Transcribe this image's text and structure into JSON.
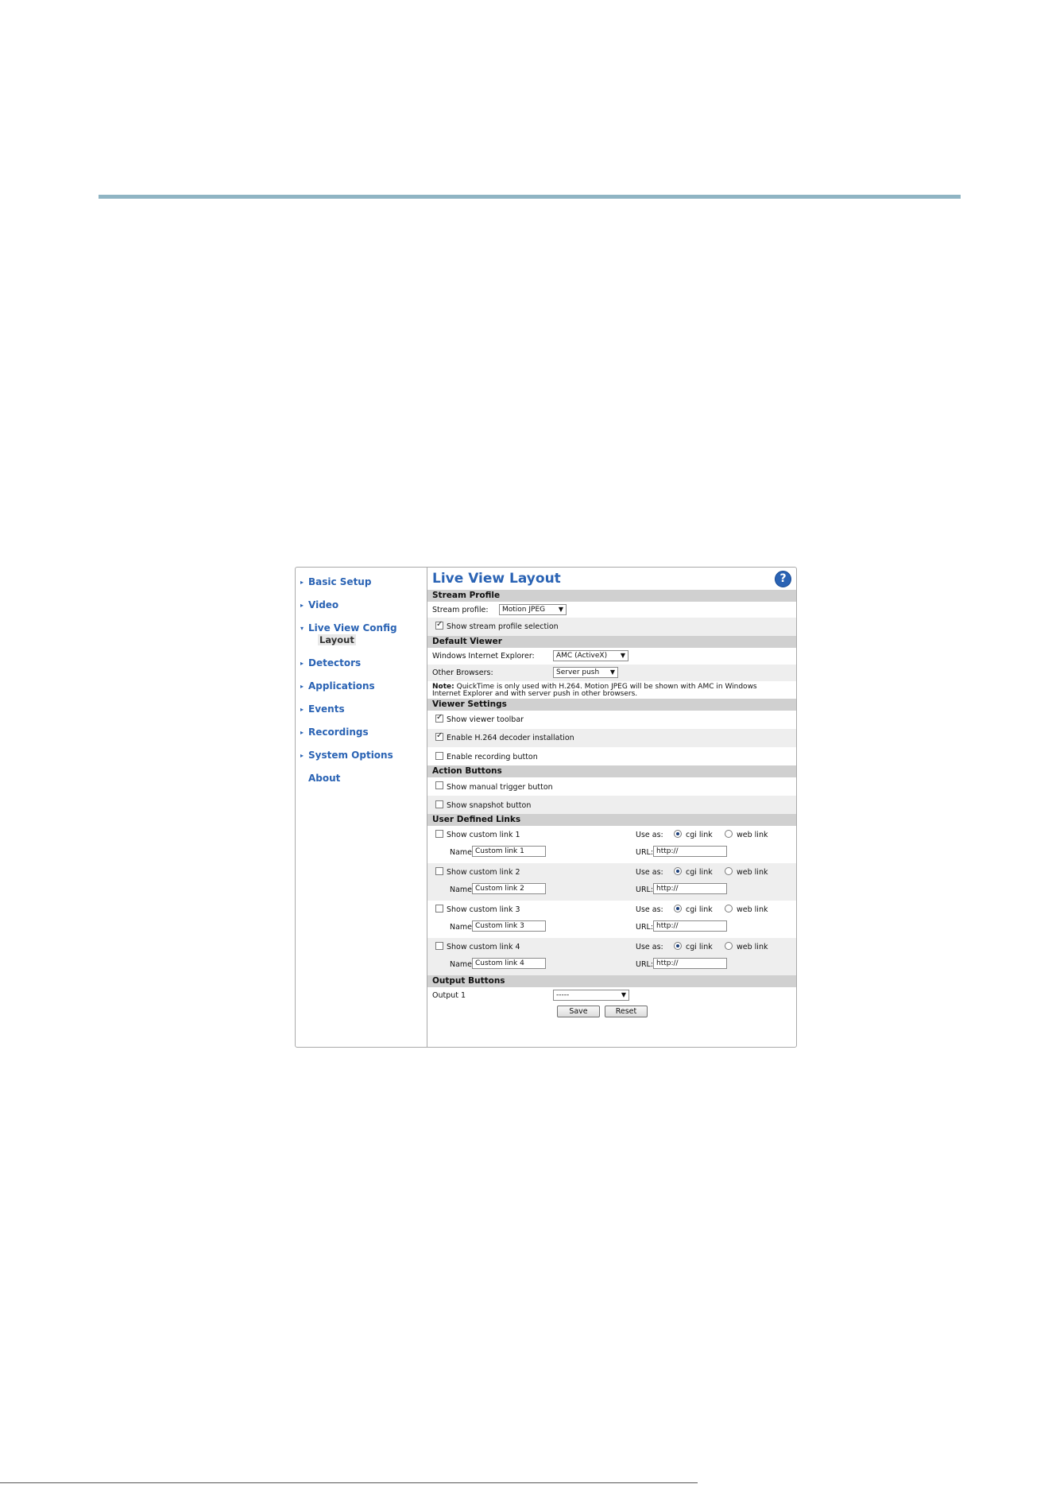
{
  "nav": {
    "items": [
      {
        "label": "Basic Setup"
      },
      {
        "label": "Video"
      },
      {
        "label": "Live View Config"
      },
      {
        "label": "Detectors"
      },
      {
        "label": "Applications"
      },
      {
        "label": "Events"
      },
      {
        "label": "Recordings"
      },
      {
        "label": "System Options"
      },
      {
        "label": "About"
      }
    ],
    "sub_item": "Layout"
  },
  "page": {
    "title": "Live View Layout",
    "help_icon": "?"
  },
  "stream_profile": {
    "header": "Stream Profile",
    "label": "Stream profile:",
    "value": "Motion JPEG",
    "show_selection_label": "Show stream profile selection",
    "show_selection_checked": true
  },
  "default_viewer": {
    "header": "Default Viewer",
    "ie_label": "Windows Internet Explorer:",
    "ie_value": "AMC (ActiveX)",
    "other_label": "Other Browsers:",
    "other_value": "Server push",
    "note_bold": "Note:",
    "note_line1": "QuickTime is only used with H.264. Motion JPEG will be shown with AMC in Windows",
    "note_line2": "Internet Explorer and with server push in other browsers."
  },
  "viewer_settings": {
    "header": "Viewer Settings",
    "items": [
      {
        "label": "Show viewer toolbar",
        "checked": true
      },
      {
        "label": "Enable H.264 decoder installation",
        "checked": true
      },
      {
        "label": "Enable recording button",
        "checked": false
      }
    ]
  },
  "action_buttons": {
    "header": "Action Buttons",
    "items": [
      {
        "label": "Show manual trigger button",
        "checked": false
      },
      {
        "label": "Show snapshot button",
        "checked": false
      }
    ]
  },
  "user_links": {
    "header": "User Defined Links",
    "use_as": "Use as:",
    "cgi": "cgi link",
    "web": "web link",
    "name_label": "Name:",
    "url_label": "URL:",
    "links": [
      {
        "label": "Show custom link 1",
        "name": "Custom link 1",
        "url": "http://"
      },
      {
        "label": "Show custom link 2",
        "name": "Custom link 2",
        "url": "http://"
      },
      {
        "label": "Show custom link 3",
        "name": "Custom link 3",
        "url": "http://"
      },
      {
        "label": "Show custom link 4",
        "name": "Custom link 4",
        "url": "http://"
      }
    ]
  },
  "output_buttons": {
    "header": "Output Buttons",
    "output_label": "Output 1",
    "output_value": "-----"
  },
  "actions": {
    "save": "Save",
    "reset": "Reset"
  }
}
